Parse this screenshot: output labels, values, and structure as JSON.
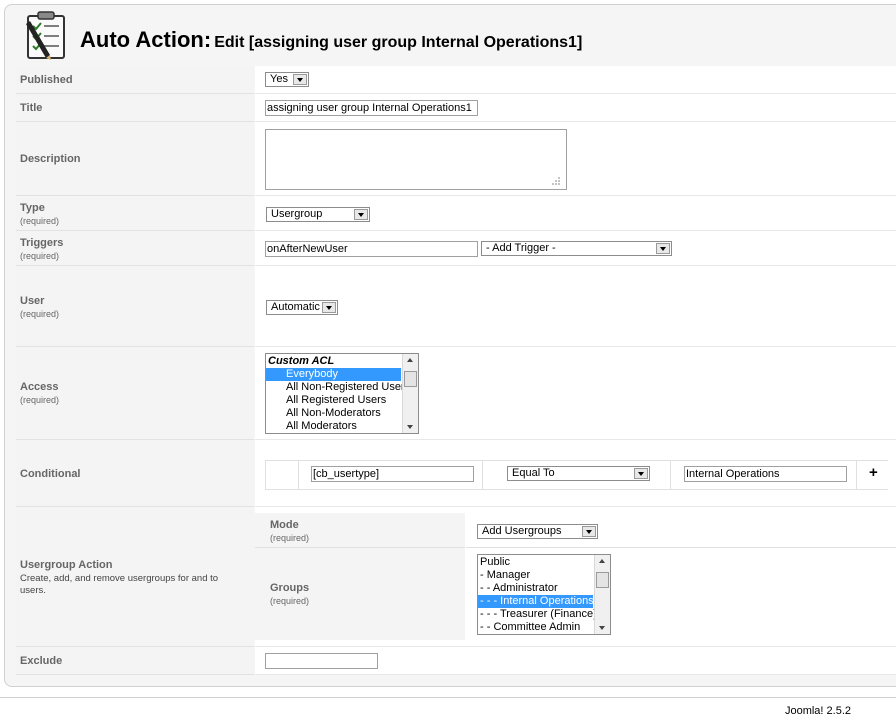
{
  "header": {
    "title_main": "Auto Action:",
    "title_sub": "Edit [assigning user group Internal Operations1]"
  },
  "required_text": "(required)",
  "published": {
    "label": "Published",
    "value": "Yes"
  },
  "title_field": {
    "label": "Title",
    "value": "assigning user group Internal Operations1"
  },
  "description": {
    "label": "Description",
    "value": ""
  },
  "type": {
    "label": "Type",
    "value": "Usergroup"
  },
  "triggers": {
    "label": "Triggers",
    "value": "onAfterNewUser",
    "add_trigger": "- Add Trigger -"
  },
  "user": {
    "label": "User",
    "value": "Automatic"
  },
  "access": {
    "label": "Access",
    "group_header": "Custom ACL",
    "options": [
      "Everybody",
      "All Non-Registered Users",
      "All Registered Users",
      "All Non-Moderators",
      "All Moderators"
    ],
    "selected": "Everybody"
  },
  "conditional": {
    "label": "Conditional",
    "field": "[cb_usertype]",
    "operator": "Equal To",
    "value": "Internal Operations",
    "add_symbol": "+"
  },
  "usergroup_action": {
    "label": "Usergroup Action",
    "description": "Create, add, and remove usergroups for and to users.",
    "mode": {
      "label": "Mode",
      "value": "Add Usergroups"
    },
    "groups": {
      "label": "Groups",
      "options": [
        "Public",
        "- Manager",
        "- - Administrator",
        "- - - Internal Operations",
        "- - - Treasurer (Finance)",
        "- - Committee Admin"
      ],
      "selected": "- - - Internal Operations"
    }
  },
  "exclude": {
    "label": "Exclude",
    "value": ""
  },
  "footer": {
    "version": "Joomla! 2.5.2"
  }
}
